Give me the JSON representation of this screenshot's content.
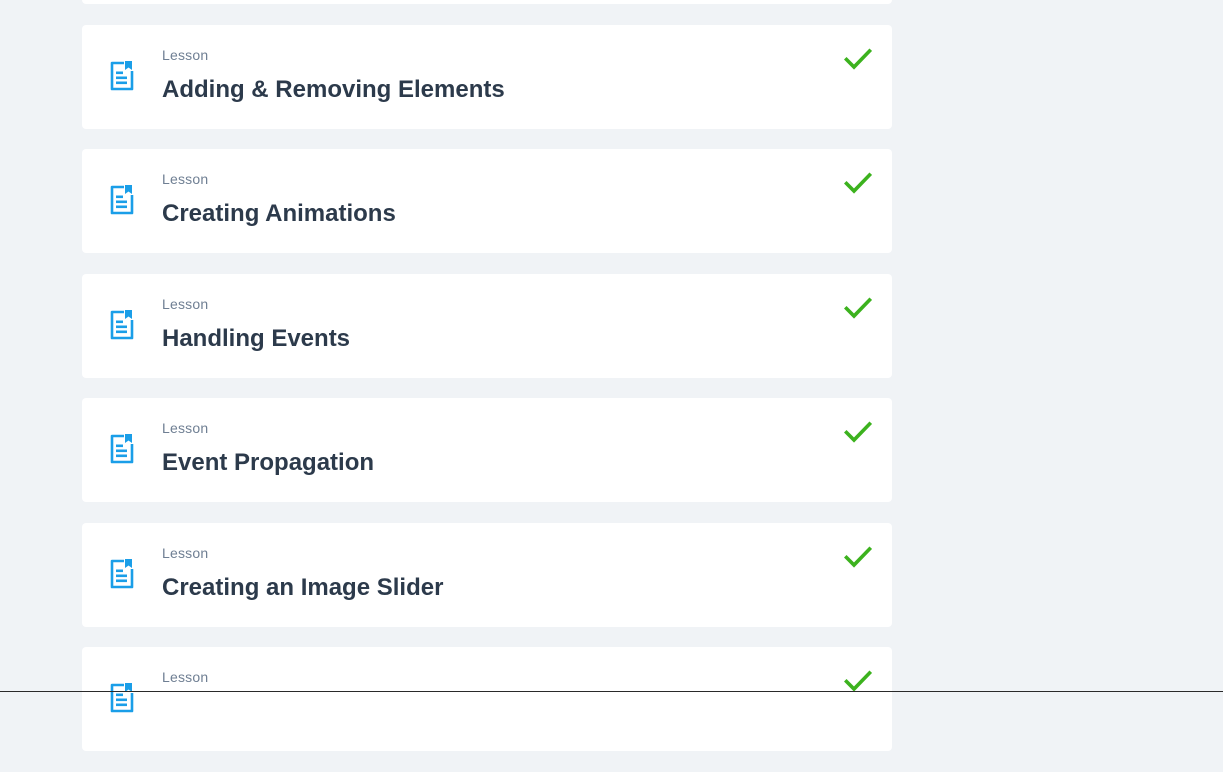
{
  "colors": {
    "background": "#f0f3f6",
    "card": "#ffffff",
    "icon_blue": "#1a9ee8",
    "check_green": "#3cb21e",
    "title_text": "#2c3a4b",
    "type_text": "#6f7f93"
  },
  "lessons": [
    {
      "type": "",
      "title": "",
      "icon": "document-icon",
      "status_icon": "check-icon"
    },
    {
      "type": "Lesson",
      "title": "Adding & Removing Elements",
      "icon": "document-icon",
      "status_icon": "check-icon"
    },
    {
      "type": "Lesson",
      "title": "Creating Animations",
      "icon": "document-icon",
      "status_icon": "check-icon"
    },
    {
      "type": "Lesson",
      "title": "Handling Events",
      "icon": "document-icon",
      "status_icon": "check-icon"
    },
    {
      "type": "Lesson",
      "title": "Event Propagation",
      "icon": "document-icon",
      "status_icon": "check-icon"
    },
    {
      "type": "Lesson",
      "title": "Creating an Image Slider",
      "icon": "document-icon",
      "status_icon": "check-icon"
    },
    {
      "type": "Lesson",
      "title": "",
      "icon": "document-icon",
      "status_icon": "check-icon"
    }
  ]
}
